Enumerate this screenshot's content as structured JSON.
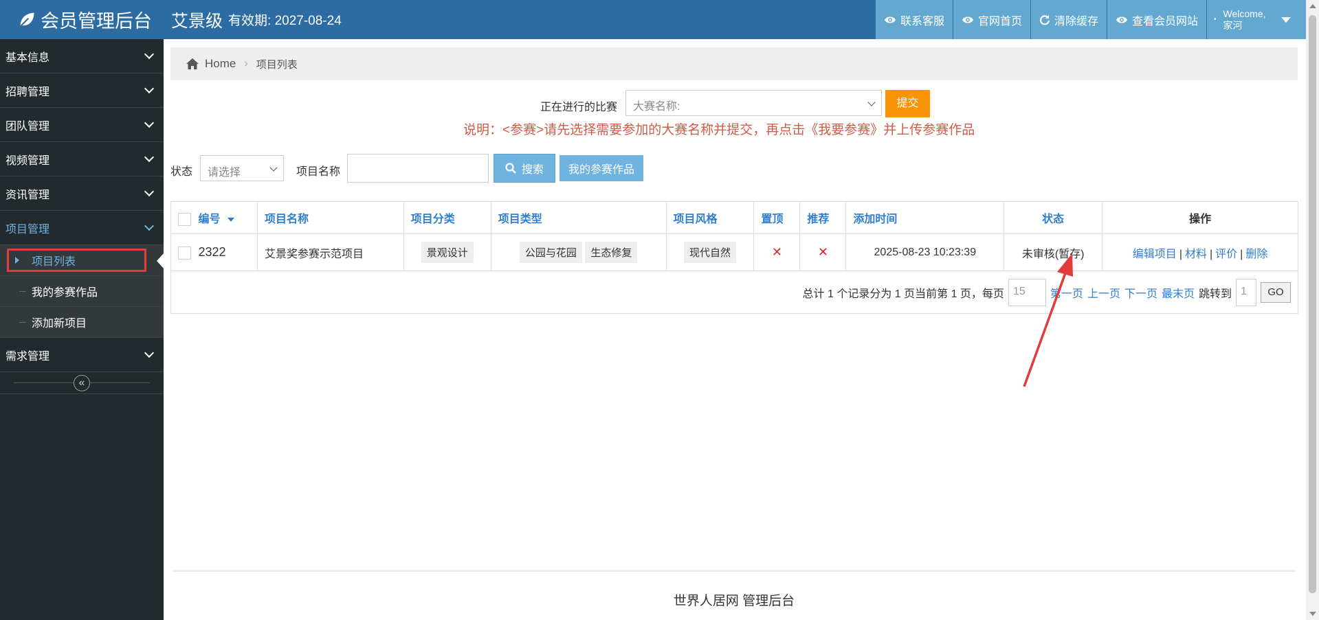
{
  "header": {
    "title": "会员管理后台",
    "user": "艾景级",
    "valid_label": "有效期: 2027-08-24",
    "nav": [
      {
        "label": "联系客服",
        "icon": "eye-icon"
      },
      {
        "label": "官网首页",
        "icon": "eye-icon"
      },
      {
        "label": "清除缓存",
        "icon": "refresh-icon"
      },
      {
        "label": "查看会员网站",
        "icon": "eye-icon"
      }
    ],
    "welcome_line1": "Welcome,",
    "welcome_line2": "家河"
  },
  "sidebar": {
    "items": [
      {
        "label": "基本信息"
      },
      {
        "label": "招聘管理"
      },
      {
        "label": "团队管理"
      },
      {
        "label": "视频管理"
      },
      {
        "label": "资讯管理"
      },
      {
        "label": "项目管理"
      }
    ],
    "subitems": [
      {
        "label": "项目列表"
      },
      {
        "label": "我的参赛作品"
      },
      {
        "label": "添加新项目"
      }
    ],
    "after_items": [
      {
        "label": "需求管理"
      }
    ],
    "collapse_icon": "«"
  },
  "breadcrumb": {
    "home": "Home",
    "current": "项目列表"
  },
  "contest": {
    "label": "正在进行的比赛",
    "select_value": "大赛名称:",
    "submit": "提交",
    "notice": "说明：<参赛>请先选择需要参加的大赛名称并提交，再点击《我要参赛》并上传参赛作品"
  },
  "filters": {
    "status_label": "状态",
    "status_value": "请选择",
    "name_label": "项目名称",
    "name_value": "",
    "search_button": "搜索",
    "mywork_button": "我的参赛作品"
  },
  "table": {
    "headers": {
      "id": "编号",
      "name": "项目名称",
      "category": "项目分类",
      "type": "项目类型",
      "style": "项目风格",
      "top": "置顶",
      "recommend": "推荐",
      "added": "添加时间",
      "status": "状态",
      "ops": "操作"
    },
    "rows": [
      {
        "id": "2322",
        "name": "艾景奖参赛示范项目",
        "category": "景观设计",
        "type1": "公园与花园",
        "type2": "生态修复",
        "style": "现代自然",
        "top": "✕",
        "recommend": "✕",
        "added": "2025-08-23 10:23:39",
        "status": "未审核(暂存)",
        "op_edit": "编辑项目",
        "op_material": "材料",
        "op_review": "评价",
        "op_delete": "删除",
        "sep": "|"
      }
    ]
  },
  "pager": {
    "summary": "总计 1 个记录分为 1 页当前第 1 页，每页",
    "per_page": "15",
    "first": "第一页",
    "prev": "上一页",
    "next": "下一页",
    "last": "最末页",
    "jump_label": "跳转到",
    "jump_value": "1",
    "go": "GO"
  },
  "footer": {
    "text": "世界人居网 管理后台"
  },
  "colors": {
    "header": "#2d6ca2",
    "nav_item": "#62a8d1",
    "sidebar": "#222a2d",
    "accent": "#307ecc",
    "submit": "#f89406",
    "notice": "#d15b47",
    "annotation": "#e23b3b"
  }
}
